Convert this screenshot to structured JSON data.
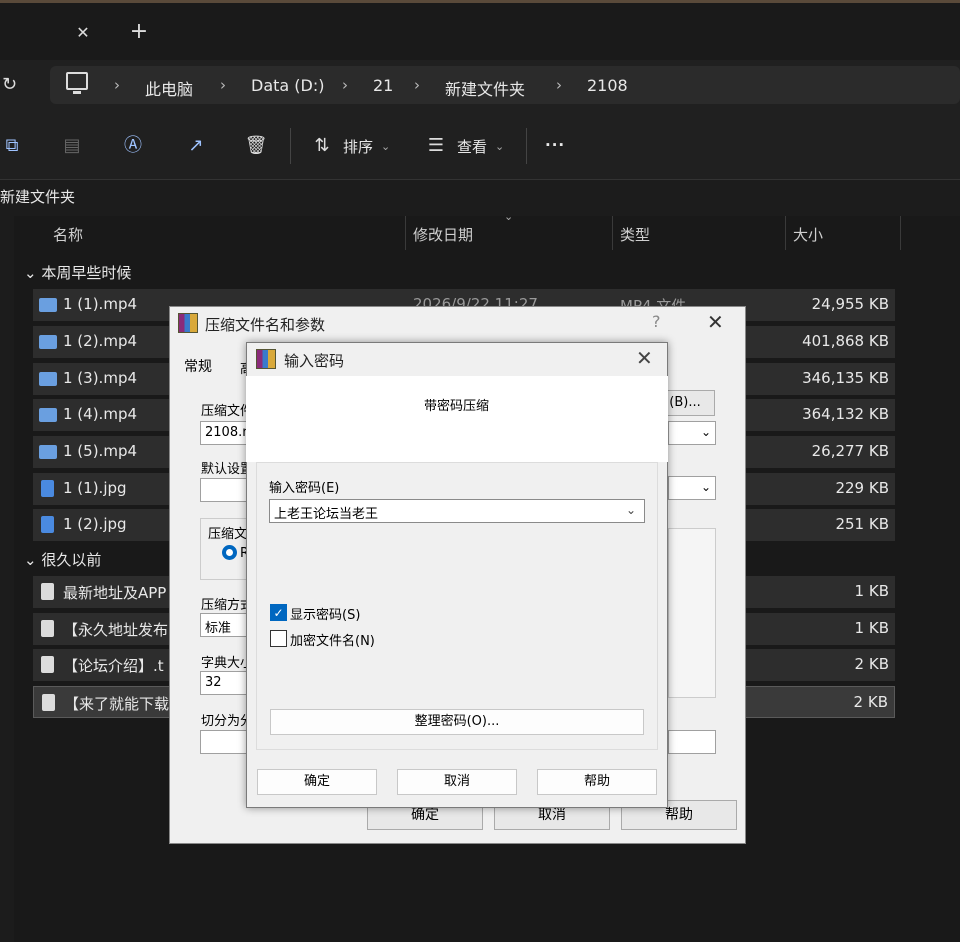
{
  "tabs": {
    "close_glyph": "✕",
    "new_glyph": "+"
  },
  "address": {
    "crumbs": [
      "此电脑",
      "Data (D:)",
      "21",
      "新建文件夹",
      "2108"
    ]
  },
  "toolbar": {
    "sort_label": "排序",
    "view_label": "查看",
    "more_label": "···"
  },
  "folder_title": "新建文件夹",
  "columns": {
    "name": "名称",
    "date": "修改日期",
    "type": "类型",
    "size": "大小"
  },
  "groups": {
    "recent": "本周早些时候",
    "old": "很久以前"
  },
  "files": [
    {
      "name": "1 (1).mp4",
      "size": "24,955 KB"
    },
    {
      "name": "1 (2).mp4",
      "size": "401,868 KB"
    },
    {
      "name": "1 (3).mp4",
      "size": "346,135 KB"
    },
    {
      "name": "1 (4).mp4",
      "size": "364,132 KB"
    },
    {
      "name": "1 (5).mp4",
      "size": "26,277 KB"
    },
    {
      "name": "1 (1).jpg",
      "size": "229 KB"
    },
    {
      "name": "1 (2).jpg",
      "size": "251 KB"
    },
    {
      "name": "最新地址及APP",
      "size": "1 KB"
    },
    {
      "name": "【永久地址发布",
      "size": "1 KB"
    },
    {
      "name": "【论坛介绍】.t",
      "size": "2 KB"
    },
    {
      "name": "【来了就能下载",
      "size": "2 KB"
    }
  ],
  "row1_partial": {
    "date": "2026/9/22 11:27",
    "type": "MP4 文件"
  },
  "archive_dialog": {
    "title": "压缩文件名和参数",
    "help_glyph": "?",
    "close_glyph": "✕",
    "tab_general": "常规",
    "tab_partial": "高",
    "label_archive_name": "压缩文件",
    "archive_name_value": "2108.r",
    "label_default": "默认设置",
    "label_format": "压缩文",
    "format_partial": "R",
    "label_method": "压缩方式",
    "method_value": "标准",
    "label_dict": "字典大小",
    "dict_value": "32",
    "label_split": "切分为分",
    "browse_button": "(B)...",
    "ok": "确定",
    "cancel": "取消",
    "help": "帮助"
  },
  "password_dialog": {
    "title": "输入密码",
    "close_glyph": "✕",
    "subtitle": "带密码压缩",
    "password_label": "输入密码(E)",
    "password_value": "上老王论坛当老王",
    "show_password": "显示密码(S)",
    "encrypt_names": "加密文件名(N)",
    "organize_button": "整理密码(O)...",
    "ok": "确定",
    "cancel": "取消",
    "help": "帮助"
  }
}
